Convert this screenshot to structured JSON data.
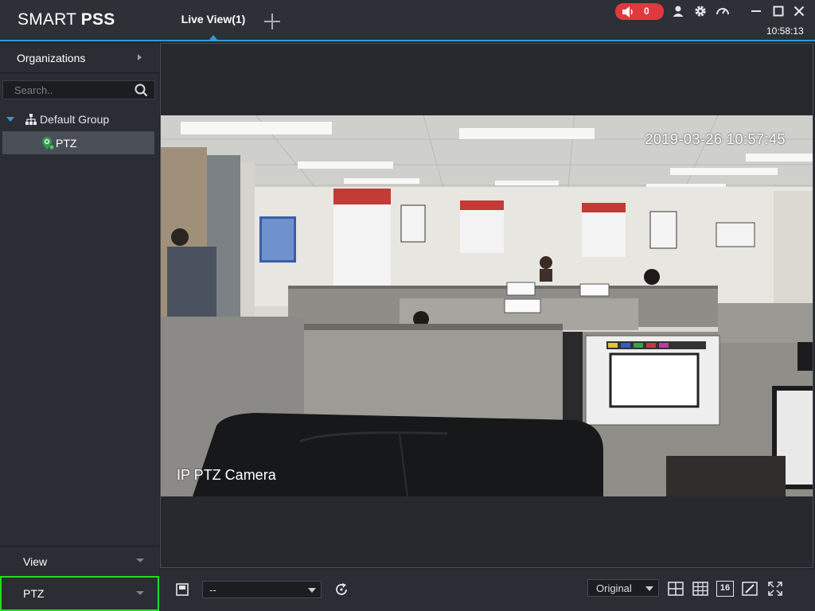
{
  "app": {
    "logo_light": "SMART ",
    "logo_bold": "PSS",
    "clock": "10:58:13"
  },
  "tabs": [
    {
      "label": "Live View(1)",
      "active": true
    }
  ],
  "alarm": {
    "count": "0",
    "color": "#e0393d"
  },
  "title_icons": [
    "user-icon",
    "gear-icon",
    "speedometer-icon",
    "minimize-icon",
    "maximize-icon",
    "close-icon"
  ],
  "sidebar": {
    "organizations_label": "Organizations",
    "search_placeholder": "Search..",
    "group_label": "Default Group",
    "device_label": "PTZ",
    "view_label": "View",
    "ptz_label": "PTZ"
  },
  "video": {
    "osd_timestamp": "2019-03-26 10:57:45",
    "osd_camera_name": "IP PTZ Camera"
  },
  "toolbar": {
    "preset_value": "--",
    "ratio_value": "Original",
    "layout_16_label": "16"
  },
  "colors": {
    "accent": "#2f9ad8",
    "highlight": "#1ee01e"
  }
}
